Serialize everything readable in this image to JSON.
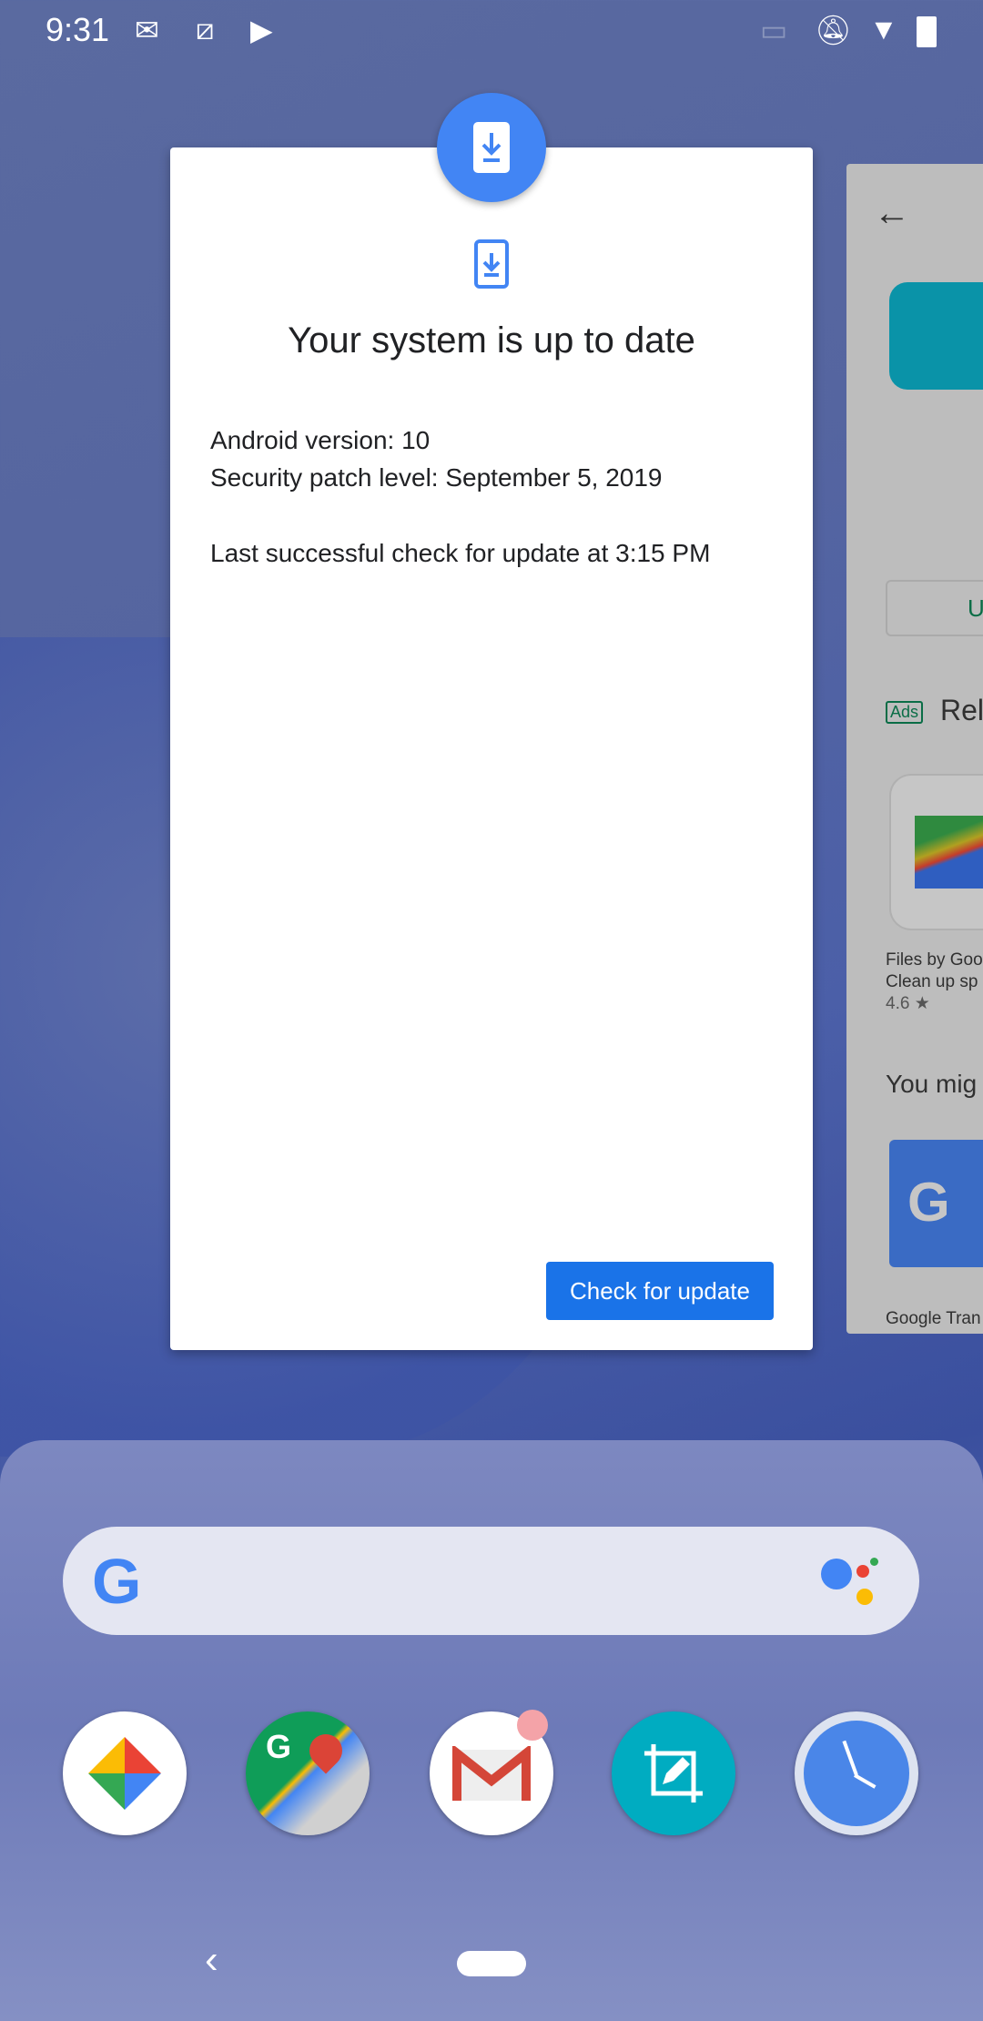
{
  "status_bar": {
    "time": "9:31",
    "icons": [
      "gmail-icon",
      "screenshot-edit-icon",
      "play-store-icon",
      "cast-icon",
      "bell-off-icon",
      "wifi-icon",
      "battery-icon"
    ]
  },
  "system_update_card": {
    "title": "Your system is up to date",
    "android_version": "Android version: 10",
    "security_patch": "Security patch level: September 5, 2019",
    "last_check": "Last successful check for update at 3:15 PM",
    "button": "Check for update",
    "accent": "#1a73e8"
  },
  "play_store_card": {
    "update_button": "U",
    "ads_badge": "Ads",
    "section1": "Rel",
    "app1_name": "Files by Goo",
    "app1_desc": "Clean up sp",
    "app1_rating": "4.6 ★",
    "section2": "You mig",
    "app2_name": "Google Tran"
  },
  "dock": {
    "apps": [
      "Photos",
      "Maps",
      "Gmail",
      "Screen edit",
      "Clock"
    ]
  }
}
